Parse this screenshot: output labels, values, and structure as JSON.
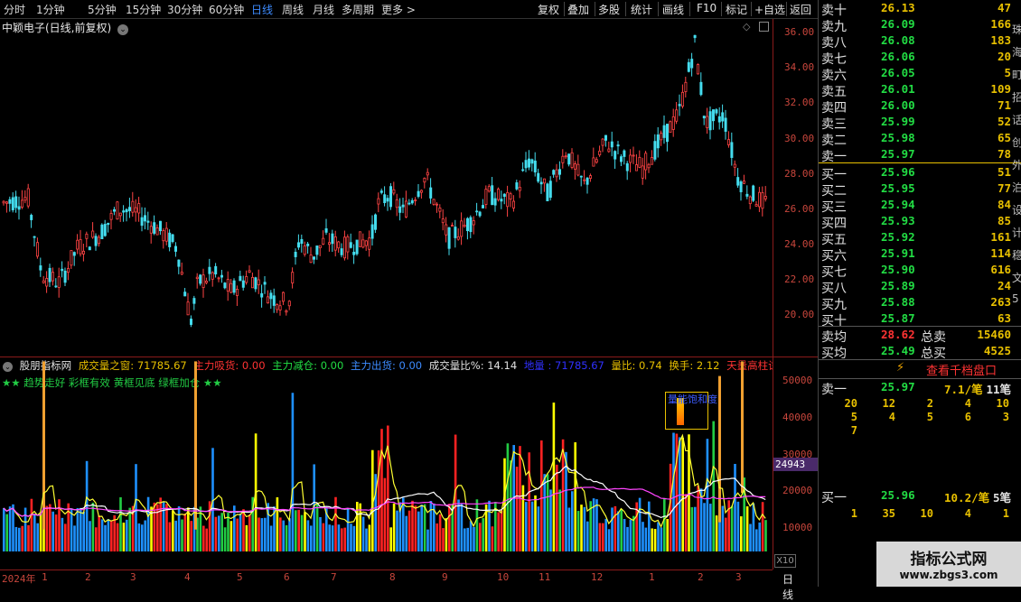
{
  "period_tabs": [
    "分时",
    "1分钟",
    "5分钟",
    "15分钟",
    "30分钟",
    "60分钟",
    "日线",
    "周线",
    "月线",
    "多周期",
    "更多 >"
  ],
  "active_period": "日线",
  "toolbar": [
    "复权",
    "叠加",
    "多股",
    "统计",
    "画线",
    "F10",
    "标记",
    "+自选",
    "返回"
  ],
  "stock_title": "中颖电子(日线,前复权)",
  "price_axis": [
    "36.00",
    "34.00",
    "32.00",
    "30.00",
    "28.00",
    "26.00",
    "24.00",
    "22.00",
    "20.00"
  ],
  "vol_axis": [
    "50000",
    "40000",
    "30000",
    "20000",
    "10000"
  ],
  "current_vol_badge": "24943",
  "x10_label": "X10",
  "date_labels": [
    "2024年",
    "1",
    "2",
    "3",
    "4",
    "5",
    "6",
    "7",
    "8",
    "9",
    "10",
    "11",
    "12",
    "1",
    "2",
    "3"
  ],
  "period_badge": "日线",
  "indicator": {
    "name": "股朋指标网",
    "items": [
      {
        "label": "成交量之窗: 71785.67",
        "color": "#e8c000"
      },
      {
        "label": "主力吸货: 0.00",
        "color": "#ff3333"
      },
      {
        "label": "主力减仓: 0.00",
        "color": "#22dd44"
      },
      {
        "label": "主力出货: 0.00",
        "color": "#3d8bff"
      },
      {
        "label": "成交量比%: 14.14",
        "color": "#e0e0e0"
      },
      {
        "label": "地量 : 71785.67",
        "color": "#3030ff"
      },
      {
        "label": "量比: 0.74",
        "color": "#e8c000"
      },
      {
        "label": "换手: 2.12",
        "color": "#e8c000"
      },
      {
        "label": "天量高柱试顶:",
        "color": "#ff3333"
      }
    ],
    "star_line": "★★ 趋势走好 彩框有效  黄框见底 绿框加仓 ★★",
    "box_label": "量能饱和度"
  },
  "order_book": {
    "sell": [
      {
        "name": "卖十",
        "price": "26.13",
        "vol": "47"
      },
      {
        "name": "卖九",
        "price": "26.09",
        "vol": "166"
      },
      {
        "name": "卖八",
        "price": "26.08",
        "vol": "183"
      },
      {
        "name": "卖七",
        "price": "26.06",
        "vol": "20"
      },
      {
        "name": "卖六",
        "price": "26.05",
        "vol": "5"
      },
      {
        "name": "卖五",
        "price": "26.01",
        "vol": "109"
      },
      {
        "name": "卖四",
        "price": "26.00",
        "vol": "71"
      },
      {
        "name": "卖三",
        "price": "25.99",
        "vol": "52"
      },
      {
        "name": "卖二",
        "price": "25.98",
        "vol": "65"
      },
      {
        "name": "卖一",
        "price": "25.97",
        "vol": "78"
      }
    ],
    "buy": [
      {
        "name": "买一",
        "price": "25.96",
        "vol": "51"
      },
      {
        "name": "买二",
        "price": "25.95",
        "vol": "77"
      },
      {
        "name": "买三",
        "price": "25.94",
        "vol": "84"
      },
      {
        "name": "买四",
        "price": "25.93",
        "vol": "85"
      },
      {
        "name": "买五",
        "price": "25.92",
        "vol": "161"
      },
      {
        "name": "买六",
        "price": "25.91",
        "vol": "114"
      },
      {
        "name": "买七",
        "price": "25.90",
        "vol": "616"
      },
      {
        "name": "买八",
        "price": "25.89",
        "vol": "24"
      },
      {
        "name": "买九",
        "price": "25.88",
        "vol": "263"
      },
      {
        "name": "买十",
        "price": "25.87",
        "vol": "63"
      }
    ],
    "sell_avg_label": "卖均",
    "sell_avg": "28.62",
    "total_sell_label": "总卖",
    "total_sell": "15460",
    "buy_avg_label": "买均",
    "buy_avg": "25.49",
    "total_buy_label": "总买",
    "total_buy": "4525"
  },
  "thousand_btn": "查看千档盘口",
  "queue_sell": {
    "label": "卖一",
    "price": "25.97",
    "per": "7.1/笔",
    "count": "11笔",
    "rows": [
      [
        "20",
        "12",
        "2",
        "4",
        "10"
      ],
      [
        "5",
        "4",
        "5",
        "6",
        "3"
      ],
      [
        "7"
      ]
    ]
  },
  "queue_buy": {
    "label": "买一",
    "price": "25.96",
    "per": "10.2/笔",
    "count": "5笔",
    "rows": [
      [
        "1",
        "35",
        "10",
        "4",
        "1"
      ]
    ]
  },
  "right_edge_chars": [
    "珠",
    "海",
    "町",
    "招",
    "话",
    "创",
    "外",
    "泊",
    "设",
    "计",
    "稳",
    "文",
    "5"
  ],
  "watermark": {
    "title": "指标公式网",
    "url": "www.zbgs3.com"
  }
}
